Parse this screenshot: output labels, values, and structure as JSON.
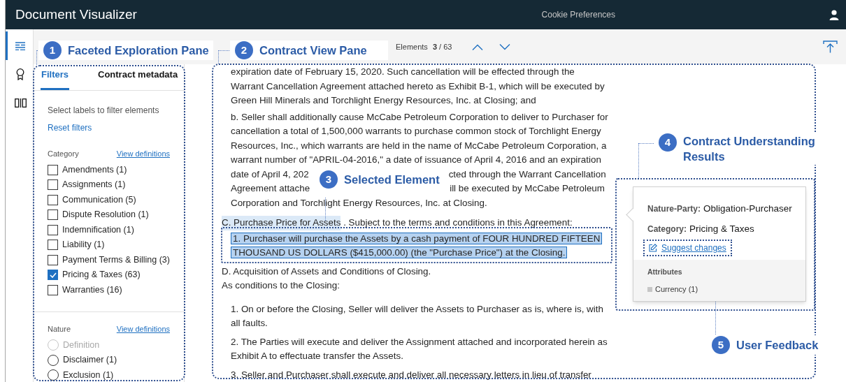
{
  "app_bar": {
    "title": "Document Visualizer",
    "link": "Cookie Preferences"
  },
  "rail": [
    {
      "kind": "list",
      "selected": true
    },
    {
      "kind": "ribbon",
      "selected": false
    },
    {
      "kind": "columns",
      "selected": false
    }
  ],
  "toolbar": {
    "label": "Elements",
    "current": "3",
    "total": "/ 63"
  },
  "filters": {
    "tabs": [
      {
        "label": "Filters",
        "selected": true
      },
      {
        "label": "Contract metadata",
        "selected": false
      }
    ],
    "hint": "Select labels to filter elements",
    "reset": "Reset filters",
    "groups": [
      {
        "title": "Category",
        "link": "View definitions",
        "kind": "checkbox",
        "options": [
          {
            "label": "Amendments (1)",
            "checked": false
          },
          {
            "label": "Assignments (1)",
            "checked": false
          },
          {
            "label": "Communication (5)",
            "checked": false
          },
          {
            "label": "Dispute Resolution (1)",
            "checked": false
          },
          {
            "label": "Indemnification (1)",
            "checked": false
          },
          {
            "label": "Liability (1)",
            "checked": false
          },
          {
            "label": "Payment Terms & Billing (3)",
            "checked": false
          },
          {
            "label": "Pricing & Taxes (63)",
            "checked": true
          },
          {
            "label": "Warranties (16)",
            "checked": false
          }
        ]
      },
      {
        "title": "Nature",
        "link": "View definitions",
        "kind": "radio",
        "options": [
          {
            "label": "Definition",
            "selected": false,
            "disabled": true
          },
          {
            "label": "Disclaimer (1)",
            "selected": false,
            "disabled": false
          },
          {
            "label": "Exclusion (1)",
            "selected": false,
            "disabled": false
          }
        ]
      }
    ]
  },
  "document": {
    "blocks": [
      {
        "kind": "para",
        "selected": false,
        "lines": [
          "expiration date of February 15, 2020. Such cancellation will be effected through the",
          "Warrant Cancellation Agreement attached hereto as Exhibit B-1, which will be executed by",
          "Green Hill Minerals and Torchlight Energy Resources, Inc. at Closing; and"
        ]
      },
      {
        "kind": "para",
        "selected": false,
        "lines": [
          "b. Seller shall additionally cause McCabe Petroleum Corporation to deliver to Purchaser for",
          "cancellation a total of 1,500,000 warrants to purchase common stock of Torchlight Energy",
          "Resources, Inc., which warrants are held in the name of McCabe Petroleum Corporation, a",
          "warrant number of \"APRIL-04-2016,\" a date of issuance of April 4, 2016 and an expiration",
          {
            "left": "date of April 4, 202",
            "right": "cted through the Warrant Cancellation"
          },
          {
            "left": "Agreement attache",
            "right": "ill be executed by McCabe Petroleum"
          },
          "Corporation and Torchlight Energy Resources, Inc. at Closing."
        ]
      },
      {
        "kind": "heading",
        "selected": false,
        "heading": "C. Purchase Price for Assets",
        "highlighted": true,
        "text": " . Subject to the terms and conditions in this Agreement:"
      },
      {
        "kind": "para",
        "selected": true,
        "lines": [
          "1. Purchaser will purchase the Assets by a cash payment of FOUR HUNDRED FIFTEEN",
          "THOUSAND US DOLLARS ($415,000.00) (the \"Purchase Price\") at the Closing."
        ]
      },
      {
        "kind": "line",
        "selected": false,
        "lines": [
          "D. Acquisition of Assets and Conditions of Closing.",
          "As conditions to the Closing:"
        ]
      },
      {
        "kind": "list",
        "selected": false,
        "items": [
          [
            "1. On or before the Closing, Seller will deliver the Assets to Purchaser as is, where is, with",
            "all faults."
          ],
          [
            "2. The Parties will execute and deliver the Assignment attached and incorporated herein as",
            "Exhibit A to effectuate transfer the Assets."
          ],
          [
            "3. Seller and Purchaser shall execute and deliver all necessary letters in lieu of transfer"
          ]
        ]
      }
    ]
  },
  "popover": {
    "fields": [
      {
        "label": "Nature-Party:",
        "value": "Obligation-Purchaser"
      },
      {
        "label": "Category:",
        "value": "Pricing & Taxes"
      }
    ],
    "action": "Suggest changes",
    "attributes_title": "Attributes",
    "attributes": [
      "Currency (1)"
    ]
  },
  "callouts": [
    {
      "number": "1",
      "label": "Faceted Exploration Pane"
    },
    {
      "number": "2",
      "label": "Contract View Pane"
    },
    {
      "number": "3",
      "label": "Selected Element"
    },
    {
      "number": "4",
      "label": "Contract Understanding Results"
    },
    {
      "number": "5",
      "label": "User Feedback"
    }
  ]
}
